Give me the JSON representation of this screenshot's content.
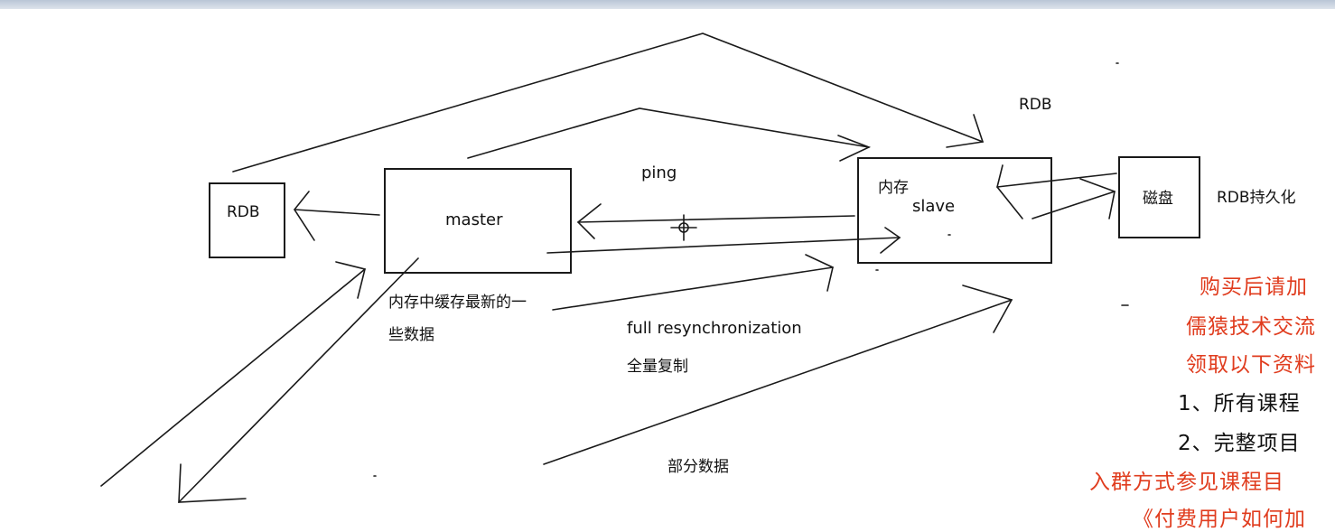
{
  "boxes": {
    "rdb_left": "RDB",
    "master": "master",
    "slave_mem": "内存",
    "slave": "slave",
    "disk": "磁盘"
  },
  "labels": {
    "ping": "ping",
    "rdb_top": "RDB",
    "rdb_persist": "RDB持久化",
    "master_note_line1": "内存中缓存最新的一",
    "master_note_line2": "些数据",
    "full_resync": "full resynchronization",
    "full_copy": "全量复制",
    "partial_data": "部分数据"
  },
  "side_panel": {
    "line1": "购买后请加",
    "line2": "儒猿技术交流",
    "line3": "领取以下资料",
    "line4": "1、所有课程",
    "line5": "2、完整项目",
    "line6": "入群方式参见课程目",
    "line7": "《付费用户如何加"
  },
  "colors": {
    "accent_red": "#e03c1e",
    "stroke": "#1a1a1a"
  }
}
